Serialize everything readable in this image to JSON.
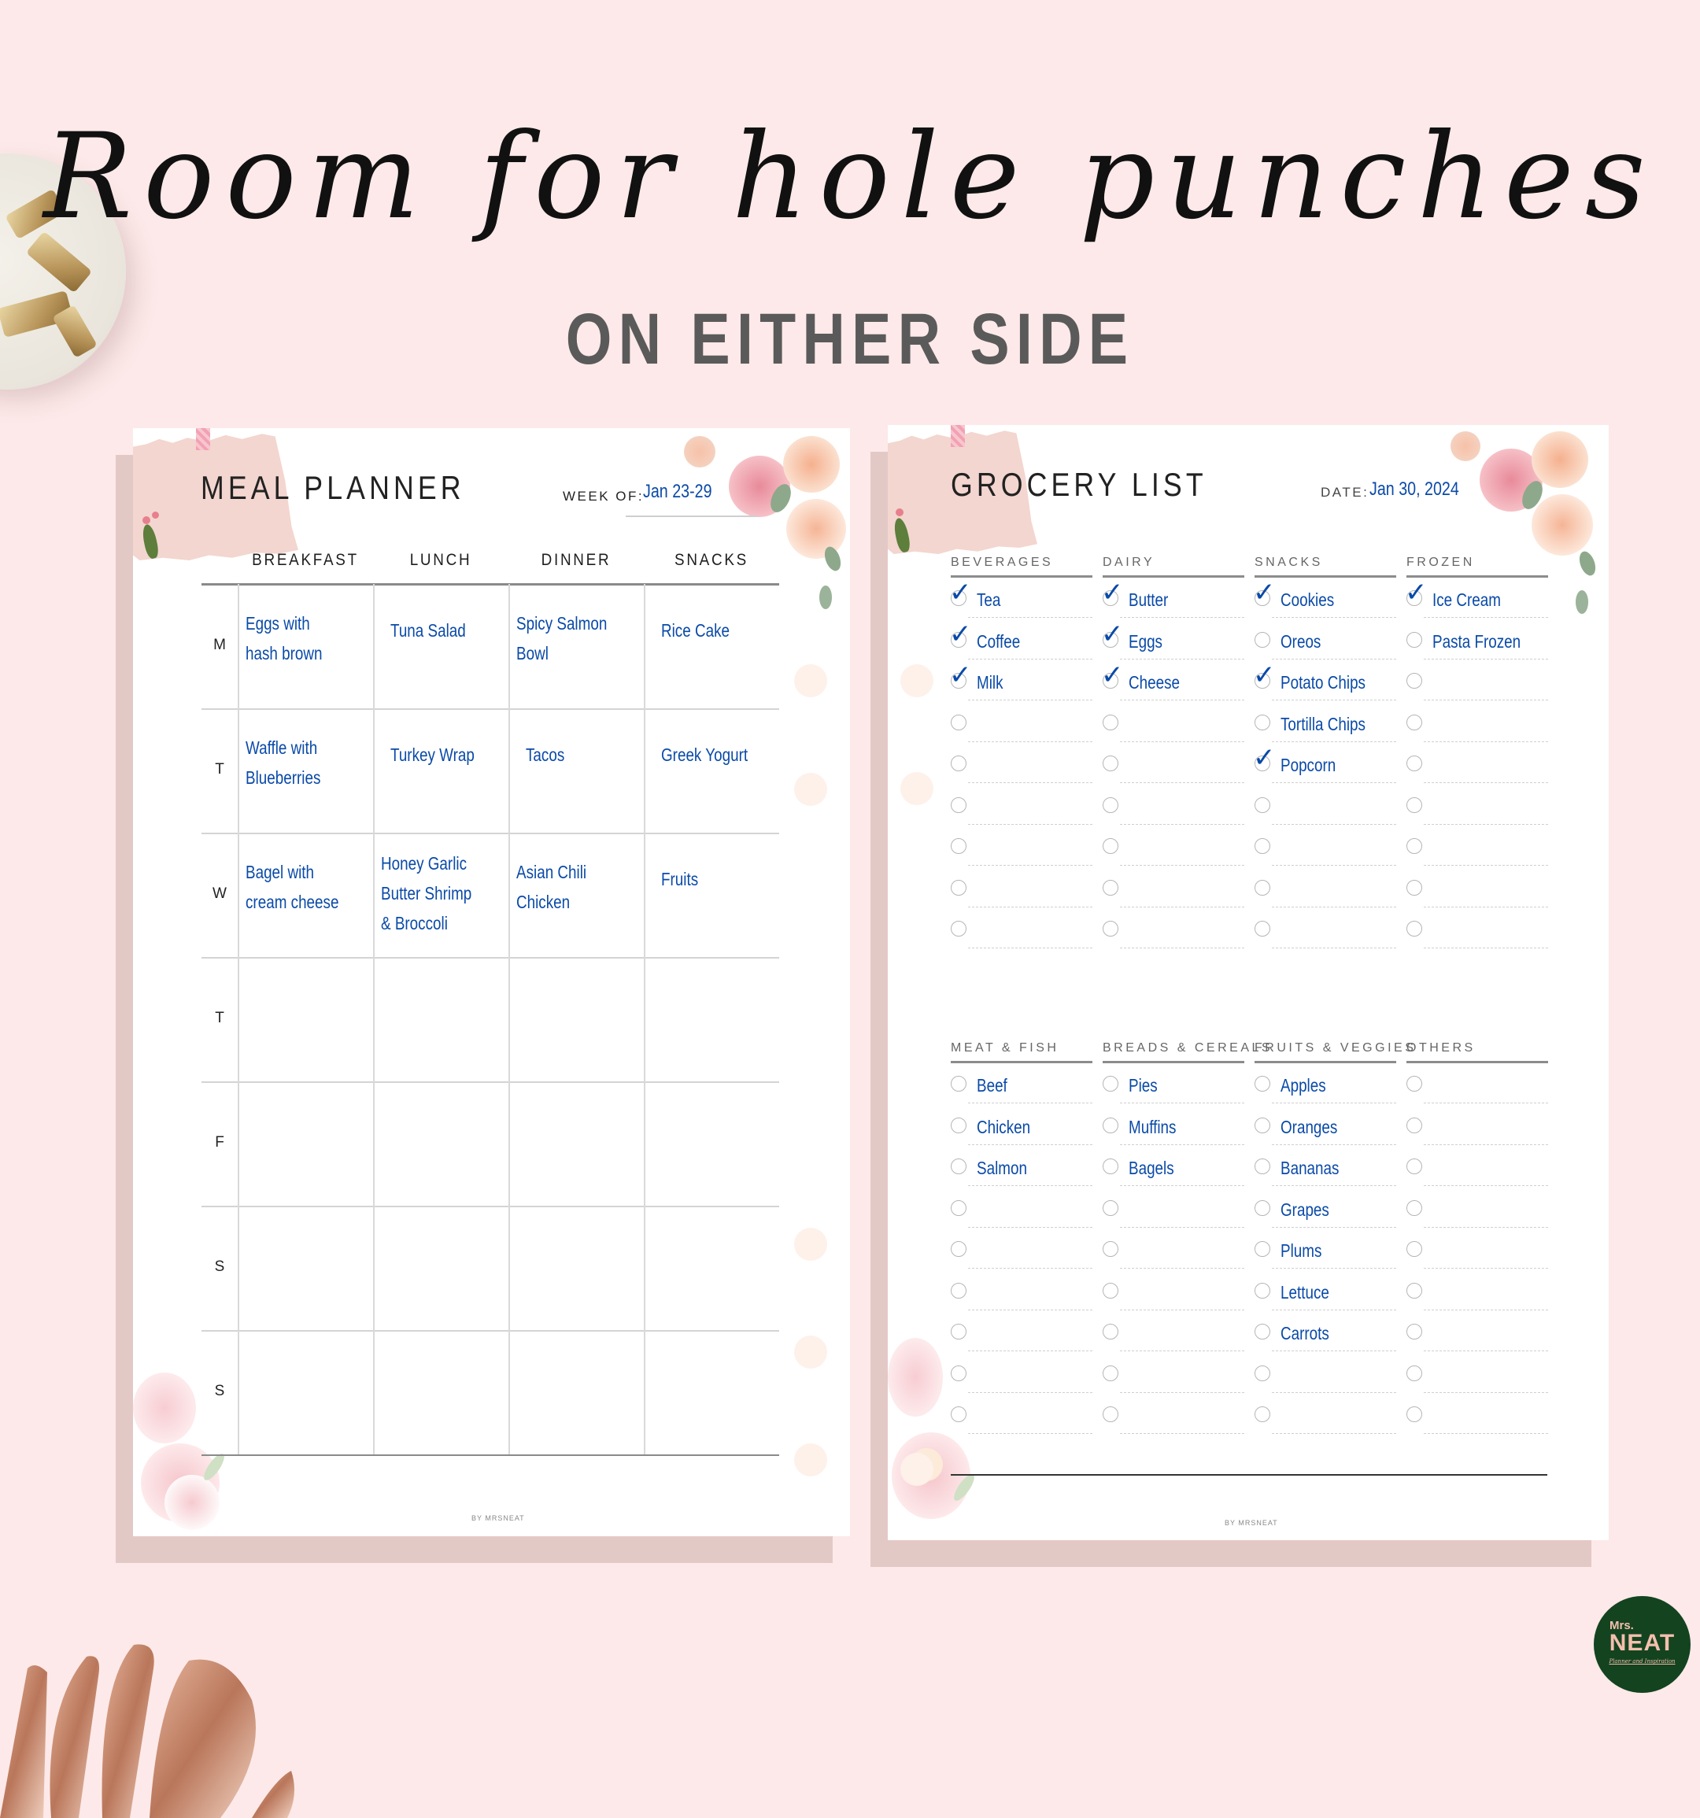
{
  "headline": {
    "script_line": "Room for hole punches",
    "subtitle": "ON EITHER SIDE"
  },
  "brand": {
    "logo_top": "Mrs.",
    "logo_main": "NEAT",
    "logo_tagline": "Planner and Inspiration",
    "colors": {
      "background": "#fde9e9",
      "ink_blue": "#0a4aa8",
      "logo_green": "#14431f",
      "logo_pink": "#f4bfae"
    }
  },
  "meal_planner": {
    "title": "MEAL PLANNER",
    "week_label": "WEEK OF:",
    "week_value": "Jan 23-29",
    "columns": [
      "BREAKFAST",
      "LUNCH",
      "DINNER",
      "SNACKS"
    ],
    "rows": [
      {
        "day": "M",
        "meals": [
          [
            "Eggs with",
            "hash brown"
          ],
          [
            "Tuna Salad"
          ],
          [
            "Spicy Salmon",
            "Bowl"
          ],
          [
            "Rice Cake"
          ]
        ]
      },
      {
        "day": "T",
        "meals": [
          [
            "Waffle with",
            "Blueberries"
          ],
          [
            "Turkey Wrap"
          ],
          [
            "Tacos"
          ],
          [
            "Greek Yogurt"
          ]
        ]
      },
      {
        "day": "W",
        "meals": [
          [
            "Bagel with",
            "cream cheese"
          ],
          [
            "Honey Garlic",
            "Butter Shrimp",
            "& Broccoli"
          ],
          [
            "Asian Chili",
            "Chicken"
          ],
          [
            "Fruits"
          ]
        ]
      },
      {
        "day": "T",
        "meals": [
          [],
          [],
          [],
          []
        ]
      },
      {
        "day": "F",
        "meals": [
          [],
          [],
          [],
          []
        ]
      },
      {
        "day": "S",
        "meals": [
          [],
          [],
          [],
          []
        ]
      },
      {
        "day": "S",
        "meals": [
          [],
          [],
          [],
          []
        ]
      }
    ],
    "footer": "BY MRSNEAT"
  },
  "grocery_list": {
    "title": "GROCERY LIST",
    "date_label": "DATE:",
    "date_value": "Jan 30, 2024",
    "sections": [
      {
        "categories": [
          {
            "name": "BEVERAGES",
            "items": [
              {
                "label": "Tea",
                "checked": true
              },
              {
                "label": "Coffee",
                "checked": true
              },
              {
                "label": "Milk",
                "checked": true
              },
              {
                "label": "",
                "checked": false
              },
              {
                "label": "",
                "checked": false
              },
              {
                "label": "",
                "checked": false
              },
              {
                "label": "",
                "checked": false
              },
              {
                "label": "",
                "checked": false
              },
              {
                "label": "",
                "checked": false
              }
            ]
          },
          {
            "name": "DAIRY",
            "items": [
              {
                "label": "Butter",
                "checked": true
              },
              {
                "label": "Eggs",
                "checked": true
              },
              {
                "label": "Cheese",
                "checked": true
              },
              {
                "label": "",
                "checked": false
              },
              {
                "label": "",
                "checked": false
              },
              {
                "label": "",
                "checked": false
              },
              {
                "label": "",
                "checked": false
              },
              {
                "label": "",
                "checked": false
              },
              {
                "label": "",
                "checked": false
              }
            ]
          },
          {
            "name": "SNACKS",
            "items": [
              {
                "label": "Cookies",
                "checked": true
              },
              {
                "label": "Oreos",
                "checked": false
              },
              {
                "label": "Potato Chips",
                "checked": true
              },
              {
                "label": "Tortilla Chips",
                "checked": false
              },
              {
                "label": "Popcorn",
                "checked": true
              },
              {
                "label": "",
                "checked": false
              },
              {
                "label": "",
                "checked": false
              },
              {
                "label": "",
                "checked": false
              },
              {
                "label": "",
                "checked": false
              }
            ]
          },
          {
            "name": "FROZEN",
            "items": [
              {
                "label": "Ice Cream",
                "checked": true
              },
              {
                "label": "Pasta Frozen",
                "checked": false
              },
              {
                "label": "",
                "checked": false
              },
              {
                "label": "",
                "checked": false
              },
              {
                "label": "",
                "checked": false
              },
              {
                "label": "",
                "checked": false
              },
              {
                "label": "",
                "checked": false
              },
              {
                "label": "",
                "checked": false
              },
              {
                "label": "",
                "checked": false
              }
            ]
          }
        ]
      },
      {
        "categories": [
          {
            "name": "MEAT & FISH",
            "items": [
              {
                "label": "Beef",
                "checked": false
              },
              {
                "label": "Chicken",
                "checked": false
              },
              {
                "label": "Salmon",
                "checked": false
              },
              {
                "label": "",
                "checked": false
              },
              {
                "label": "",
                "checked": false
              },
              {
                "label": "",
                "checked": false
              },
              {
                "label": "",
                "checked": false
              },
              {
                "label": "",
                "checked": false
              },
              {
                "label": "",
                "checked": false
              }
            ]
          },
          {
            "name": "BREADS & CEREALS",
            "items": [
              {
                "label": "Pies",
                "checked": false
              },
              {
                "label": "Muffins",
                "checked": false
              },
              {
                "label": "Bagels",
                "checked": false
              },
              {
                "label": "",
                "checked": false
              },
              {
                "label": "",
                "checked": false
              },
              {
                "label": "",
                "checked": false
              },
              {
                "label": "",
                "checked": false
              },
              {
                "label": "",
                "checked": false
              },
              {
                "label": "",
                "checked": false
              }
            ]
          },
          {
            "name": "FRUITS & VEGGIES",
            "items": [
              {
                "label": "Apples",
                "checked": false
              },
              {
                "label": "Oranges",
                "checked": false
              },
              {
                "label": "Bananas",
                "checked": false
              },
              {
                "label": "Grapes",
                "checked": false
              },
              {
                "label": "Plums",
                "checked": false
              },
              {
                "label": "Lettuce",
                "checked": false
              },
              {
                "label": "Carrots",
                "checked": false
              },
              {
                "label": "",
                "checked": false
              },
              {
                "label": "",
                "checked": false
              }
            ]
          },
          {
            "name": "OTHERS",
            "items": [
              {
                "label": "",
                "checked": false
              },
              {
                "label": "",
                "checked": false
              },
              {
                "label": "",
                "checked": false
              },
              {
                "label": "",
                "checked": false
              },
              {
                "label": "",
                "checked": false
              },
              {
                "label": "",
                "checked": false
              },
              {
                "label": "",
                "checked": false
              },
              {
                "label": "",
                "checked": false
              },
              {
                "label": "",
                "checked": false
              }
            ]
          }
        ]
      }
    ],
    "check_glyph": "✓",
    "footer": "BY MRSNEAT"
  }
}
